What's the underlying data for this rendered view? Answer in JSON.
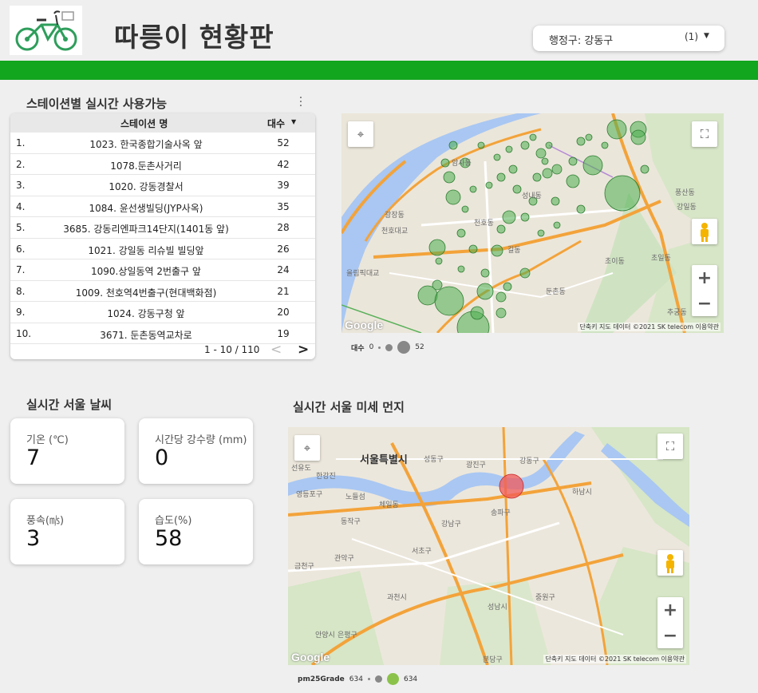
{
  "header": {
    "title": "따릉이 현황판",
    "district_label": "행정구: 강동구",
    "district_count": "(1)"
  },
  "colors": {
    "accent_bar": "#12a51e",
    "bike_bubble": "#4caf50",
    "dust_bubble": "#f05a5a"
  },
  "station_section": {
    "title": "스테이션별 실시간 사용가능",
    "col_name": "스테이션 명",
    "col_count": "대수",
    "rows": [
      {
        "rank": "1.",
        "name": "1023. 한국종합기술사옥 앞",
        "count": "52"
      },
      {
        "rank": "2.",
        "name": "1078.둔촌사거리",
        "count": "42"
      },
      {
        "rank": "3.",
        "name": "1020. 강동경찰서",
        "count": "39"
      },
      {
        "rank": "4.",
        "name": "1084. 윤선생빌딩(JYP사옥)",
        "count": "35"
      },
      {
        "rank": "5.",
        "name": "3685. 강동리엔파크14단지(1401동 앞)",
        "count": "28"
      },
      {
        "rank": "6.",
        "name": "1021. 강일동 리슈빌 빌딩앞",
        "count": "26"
      },
      {
        "rank": "7.",
        "name": "1090.상일동역 2번출구 앞",
        "count": "24"
      },
      {
        "rank": "8.",
        "name": "1009. 천호역4번출구(현대백화점)",
        "count": "21"
      },
      {
        "rank": "9.",
        "name": "1024. 강동구청 앞",
        "count": "20"
      },
      {
        "rank": "10.",
        "name": "3671. 둔촌동역교차로",
        "count": "19"
      }
    ],
    "pagination": "1 - 10 / 110"
  },
  "bike_map": {
    "labels": [
      "암사동",
      "천호대교",
      "올림픽대교",
      "천호동",
      "길동",
      "강일동",
      "초이동",
      "초일동",
      "풍산동",
      "추궁동",
      "광장동",
      "성내동",
      "둔촌동"
    ],
    "attribution": "단축키   지도 데이터 ©2021 SK telecom   이용약관",
    "google": "Google",
    "legend_label": "대수",
    "legend_min": "0",
    "legend_max": "52"
  },
  "weather": {
    "title": "실시간 서울 날씨",
    "temp_label": "기온 (℃)",
    "temp_value": "7",
    "rain_label": "시간당 강수량 (mm)",
    "rain_value": "0",
    "wind_label": "풍속(㎧)",
    "wind_value": "3",
    "humidity_label": "습도(%)",
    "humidity_value": "58"
  },
  "dust_map": {
    "title": "실시간 서울 미세 먼지",
    "city_label": "서울특별시",
    "labels": [
      "선유도",
      "한강진",
      "성동구",
      "광진구",
      "강동구",
      "하남시",
      "영등포구",
      "노들섬",
      "체일동",
      "송파구",
      "동작구",
      "강남구",
      "서초구",
      "관악구",
      "금천구",
      "과천시",
      "중원구",
      "안양시",
      "성남시",
      "분당구",
      "은평구"
    ],
    "attribution": "단축키   지도 데이터 ©2021 SK telecom   이용약관",
    "google": "Google",
    "legend_label": "pm25Grade",
    "legend_min": "634",
    "legend_max": "634"
  }
}
